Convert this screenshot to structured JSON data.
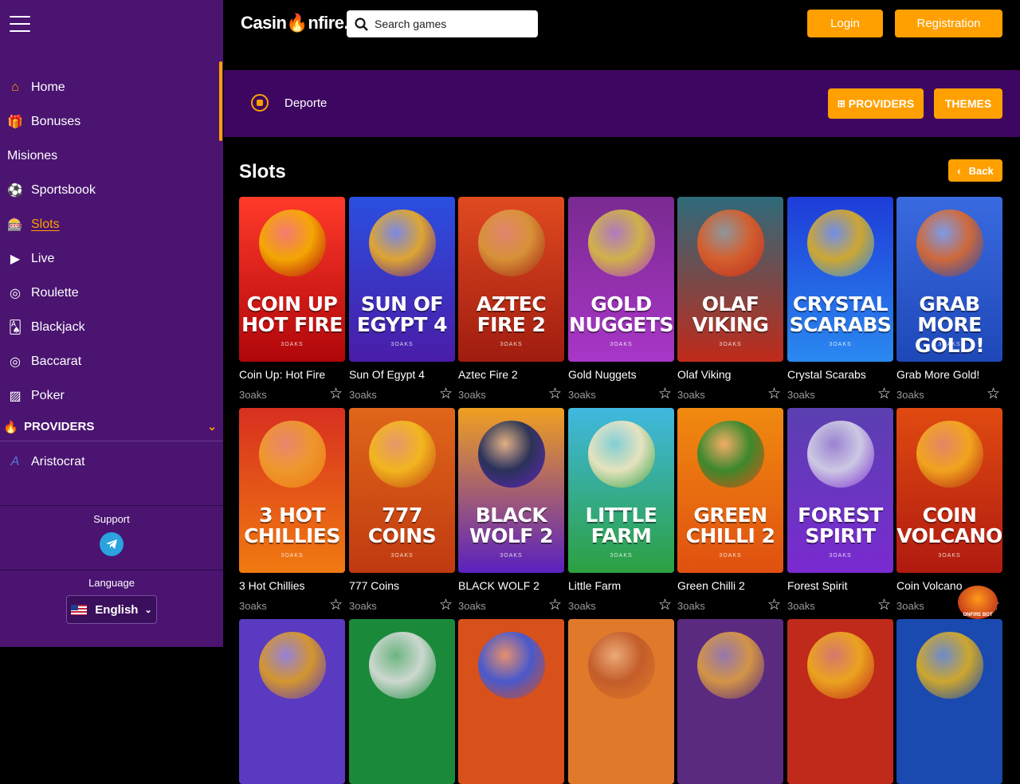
{
  "sidebar": {
    "nav_items": [
      {
        "label": "Home",
        "icon": "home-icon",
        "glyph": "⌂"
      },
      {
        "label": "Bonuses",
        "icon": "gift-icon",
        "glyph": "🎁"
      },
      {
        "label": "Misiones",
        "icon": "",
        "glyph": ""
      },
      {
        "label": "Sportsbook",
        "icon": "soccer-ball-icon",
        "glyph": "⚽"
      },
      {
        "label": "Slots",
        "icon": "slot-machine-icon",
        "glyph": "🎰"
      },
      {
        "label": "Live",
        "icon": "live-play-icon",
        "glyph": "▶"
      },
      {
        "label": "Roulette",
        "icon": "roulette-icon",
        "glyph": "◎"
      },
      {
        "label": "Blackjack",
        "icon": "cards-icon",
        "glyph": "🂡"
      },
      {
        "label": "Baccarat",
        "icon": "baccarat-icon",
        "glyph": "◎"
      },
      {
        "label": "Poker",
        "icon": "poker-icon",
        "glyph": "▨"
      }
    ],
    "providers_label": "PROVIDERS",
    "provider_items": [
      {
        "label": "Aristocrat"
      }
    ],
    "support_label": "Support",
    "language_label": "Language",
    "language_value": "English"
  },
  "header": {
    "logo_part1": "Casin",
    "logo_flame": "🔥",
    "logo_part2": "nfire.",
    "search_placeholder": "Search games",
    "login_label": "Login",
    "registration_label": "Registration"
  },
  "category_bar": {
    "sport_label": "Deporte",
    "providers_button": "PROVIDERS",
    "themes_button": "THEMES"
  },
  "section": {
    "title": "Slots",
    "back_label": "Back"
  },
  "games": [
    {
      "name": "Coin Up: Hot Fire",
      "provider": "3oaks",
      "thumb_title": "COIN UP HOT FIRE",
      "bg1": "#ff3a2a",
      "bg2": "#b0060a",
      "art": "#f5b400"
    },
    {
      "name": "Sun Of Egypt 4",
      "provider": "3oaks",
      "thumb_title": "SUN OF EGYPT 4",
      "bg1": "#2a4fe0",
      "bg2": "#4a1ca8",
      "art": "#f0b020"
    },
    {
      "name": "Aztec Fire 2",
      "provider": "3oaks",
      "thumb_title": "AZTEC FIRE 2",
      "bg1": "#e04a20",
      "bg2": "#a01c10",
      "art": "#d89a3a"
    },
    {
      "name": "Gold Nuggets",
      "provider": "3oaks",
      "thumb_title": "GOLD NUGGETS",
      "bg1": "#7a2a90",
      "bg2": "#a836c8",
      "art": "#d8c040"
    },
    {
      "name": "Olaf Viking",
      "provider": "3oaks",
      "thumb_title": "OLAF VIKING",
      "bg1": "#2e6a7a",
      "bg2": "#c02a1a",
      "art": "#e0602a"
    },
    {
      "name": "Crystal Scarabs",
      "provider": "3oaks",
      "thumb_title": "CRYSTAL SCARABS",
      "bg1": "#1e3cd8",
      "bg2": "#2a88f0",
      "art": "#e0b020"
    },
    {
      "name": "Grab More Gold!",
      "provider": "3oaks",
      "thumb_title": "GRAB MORE GOLD!",
      "bg1": "#3a6ae0",
      "bg2": "#1e48b8",
      "art": "#e06a2a"
    },
    {
      "name": "3 Hot Chillies",
      "provider": "3oaks",
      "thumb_title": "3 HOT CHILLIES",
      "bg1": "#d83020",
      "bg2": "#f07a10",
      "art": "#f0a030"
    },
    {
      "name": "777 Coins",
      "provider": "3oaks",
      "thumb_title": "777 COINS",
      "bg1": "#e0661a",
      "bg2": "#c03a10",
      "art": "#f5c020"
    },
    {
      "name": "BLACK WOLF 2",
      "provider": "3oaks",
      "thumb_title": "BLACK WOLF 2",
      "bg1": "#f0a020",
      "bg2": "#5a20c0",
      "art": "#1a2a5a"
    },
    {
      "name": "Little Farm",
      "provider": "3oaks",
      "thumb_title": "LITTLE FARM",
      "bg1": "#40b8e0",
      "bg2": "#2ca040",
      "art": "#f8e8c0"
    },
    {
      "name": "Green Chilli 2",
      "provider": "3oaks",
      "thumb_title": "GREEN CHILLI 2",
      "bg1": "#f08a10",
      "bg2": "#e05010",
      "art": "#2a8a30"
    },
    {
      "name": "Forest Spirit",
      "provider": "3oaks",
      "thumb_title": "FOREST SPIRIT",
      "bg1": "#5a40b0",
      "bg2": "#7a2ad0",
      "art": "#d8d8e8"
    },
    {
      "name": "Coin Volcano",
      "provider": "3oaks",
      "thumb_title": "COIN VOLCANO",
      "bg1": "#e04a10",
      "bg2": "#b01a10",
      "art": "#f5b020"
    },
    {
      "name": "",
      "provider": "",
      "thumb_title": "",
      "bg1": "#5a3ac0",
      "bg2": "#5a3ac0",
      "art": "#e0a020"
    },
    {
      "name": "",
      "provider": "",
      "thumb_title": "",
      "bg1": "#1a8a3a",
      "bg2": "#1a8a3a",
      "art": "#e0e0e0"
    },
    {
      "name": "",
      "provider": "",
      "thumb_title": "",
      "bg1": "#d8501a",
      "bg2": "#d8501a",
      "art": "#3a5ae0"
    },
    {
      "name": "",
      "provider": "",
      "thumb_title": "",
      "bg1": "#e07a2a",
      "bg2": "#e07a2a",
      "art": "#c05a2a"
    },
    {
      "name": "",
      "provider": "",
      "thumb_title": "",
      "bg1": "#5a2a80",
      "bg2": "#5a2a80",
      "art": "#e0a040"
    },
    {
      "name": "",
      "provider": "",
      "thumb_title": "",
      "bg1": "#c02a1a",
      "bg2": "#c02a1a",
      "art": "#f0b020"
    },
    {
      "name": "",
      "provider": "",
      "thumb_title": "",
      "bg1": "#1a4ab0",
      "bg2": "#1a4ab0",
      "art": "#e0b020"
    }
  ],
  "bot_label": "ONFIRE BOT",
  "colors": {
    "accent": "#ffa000",
    "sidebar": "#4a1470",
    "catbar": "#3d0660"
  }
}
